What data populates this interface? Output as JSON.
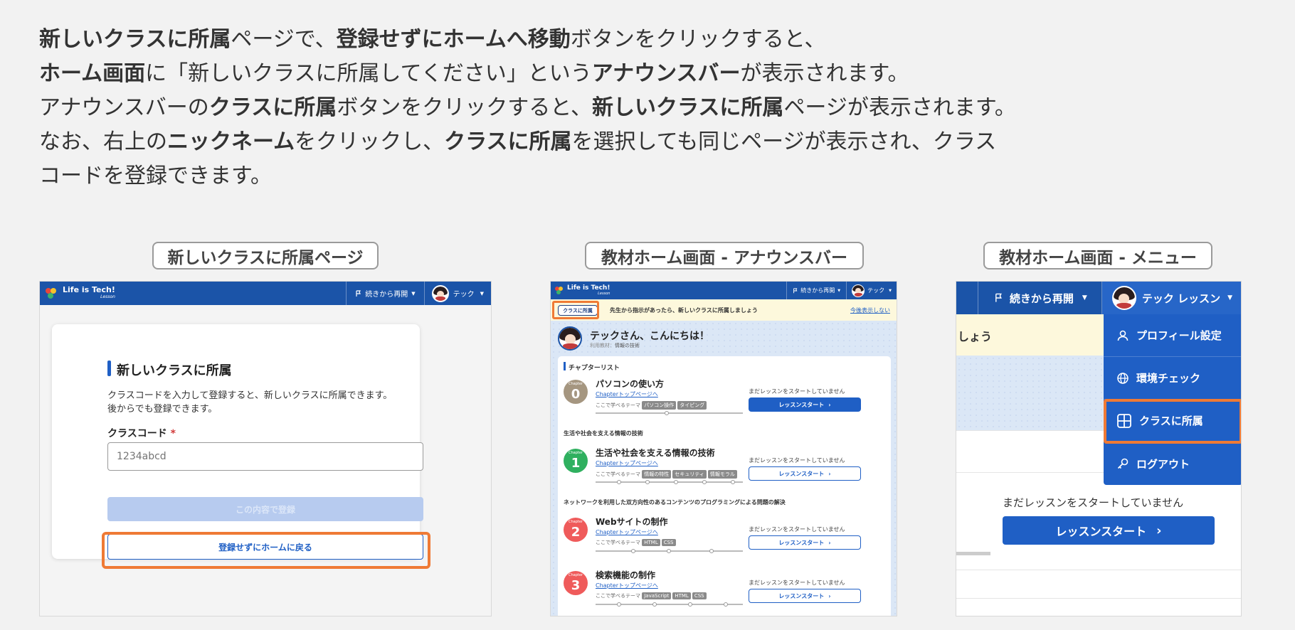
{
  "intro": {
    "line1": {
      "a": "新しいクラスに所属",
      "b": "ページで、",
      "c": "登録せずにホームへ移動",
      "d": "ボタンをクリックすると、"
    },
    "line2": {
      "a": "ホーム画面",
      "b": "に「新しいクラスに所属してください」という",
      "c": "アナウンスバー",
      "d": "が表示されます。"
    },
    "line3": {
      "a": "アナウンスバーの",
      "b": "クラスに所属",
      "c": "ボタンをクリックすると、",
      "d": "新しいクラスに所属",
      "e": "ページが表示されます。"
    },
    "line4": {
      "a": "なお、右上の",
      "b": "ニックネーム",
      "c": "をクリックし、",
      "d": "クラスに所属",
      "e": "を選択しても同じページが表示され、クラス"
    },
    "line5": "コードを登録できます。"
  },
  "captions": {
    "panel1": "新しいクラスに所属ページ",
    "panel2": "教材ホーム画面 - アナウンスバー",
    "panel3": "教材ホーム画面 - メニュー"
  },
  "colors": {
    "accent": "#1f5fc5",
    "topbar": "#1b54a8",
    "highlight": "#ef7a35"
  },
  "header": {
    "logo": "Life is Tech!",
    "logo_sub": "Lesson",
    "resume": "続きから再開",
    "user_short": "テック",
    "user_full": "テック レッスン"
  },
  "join_page": {
    "title": "新しいクラスに所属",
    "desc1": "クラスコードを入力して登録すると、新しいクラスに所属できます。",
    "desc2": "後からでも登録できます。",
    "code_label": "クラスコード",
    "required_mark": "*",
    "code_placeholder": "1234abcd",
    "submit_label": "この内容で登録",
    "skip_label": "登録せずにホームに戻る"
  },
  "home": {
    "announce_button": "クラスに所属",
    "announce_text": "先生から指示があったら、新しいクラスに所属しましょう",
    "announce_hide": "今後表示しない",
    "greeting": "テックさん、こんにちは！",
    "material_label": "利用教材：",
    "material": "情報の技術",
    "chapter_list": "チャプターリスト",
    "chapter_word": "Chapter",
    "top_link": "Chapterトップページへ",
    "theme_label": "ここで学べるテーマ",
    "not_started": "まだレッスンをスタートしていません",
    "start_label": "レッスンスタート",
    "section1": "生活や社会を支える情報の技術",
    "section2": "ネットワークを利用した双方向性のあるコンテンツのプログラミングによる問題の解決",
    "chapters": [
      {
        "num": "0",
        "title": "パソコンの使い方",
        "tags": [
          "パソコン操作",
          "タイピング"
        ]
      },
      {
        "num": "1",
        "title": "生活や社会を支える情報の技術",
        "tags": [
          "情報の特性",
          "セキュリティ",
          "情報モラル"
        ]
      },
      {
        "num": "2",
        "title": "Webサイトの制作",
        "tags": [
          "HTML",
          "CSS"
        ]
      },
      {
        "num": "3",
        "title": "検索機能の制作",
        "tags": [
          "JavaScript",
          "HTML",
          "CSS"
        ]
      }
    ]
  },
  "menu": {
    "banner_fragment": "しょう",
    "items": [
      "プロフィール設定",
      "環境チェック",
      "クラスに所属",
      "ログアウト"
    ],
    "not_started": "まだレッスンをスタートしていません",
    "start_label": "レッスンスタート"
  }
}
